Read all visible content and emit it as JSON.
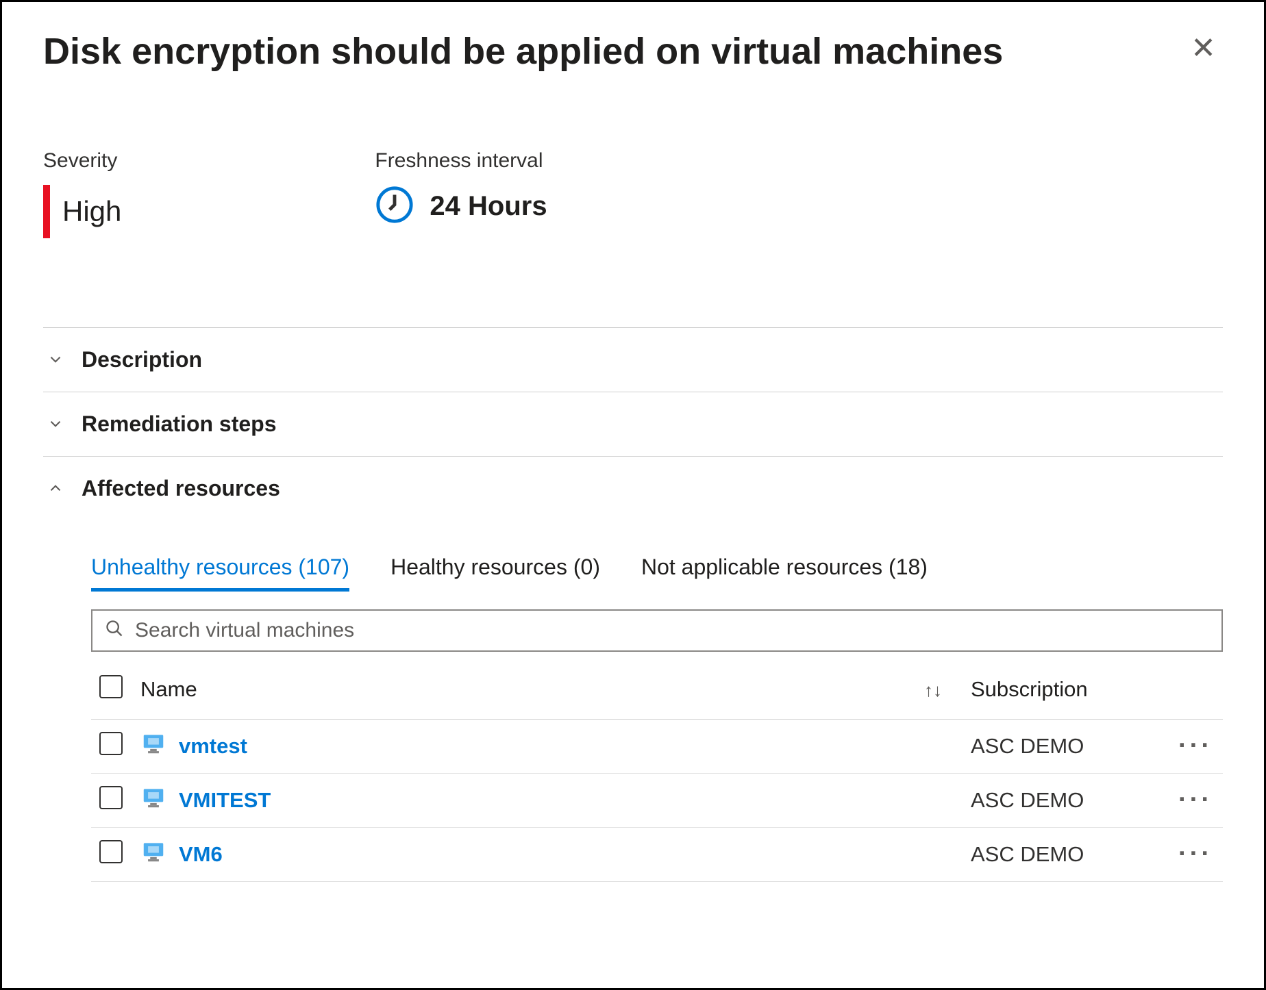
{
  "header": {
    "title": "Disk encryption should be applied on virtual machines"
  },
  "meta": {
    "severity_label": "Severity",
    "severity_value": "High",
    "freshness_label": "Freshness interval",
    "freshness_value": "24 Hours"
  },
  "sections": {
    "description": "Description",
    "remediation": "Remediation steps",
    "affected": "Affected resources"
  },
  "tabs": {
    "unhealthy": "Unhealthy resources (107)",
    "healthy": "Healthy resources (0)",
    "na": "Not applicable resources (18)"
  },
  "search": {
    "placeholder": "Search virtual machines"
  },
  "columns": {
    "name": "Name",
    "subscription": "Subscription"
  },
  "rows": [
    {
      "name": "vmtest",
      "subscription": "ASC DEMO"
    },
    {
      "name": "VMITEST",
      "subscription": "ASC DEMO"
    },
    {
      "name": "VM6",
      "subscription": "ASC DEMO"
    }
  ]
}
